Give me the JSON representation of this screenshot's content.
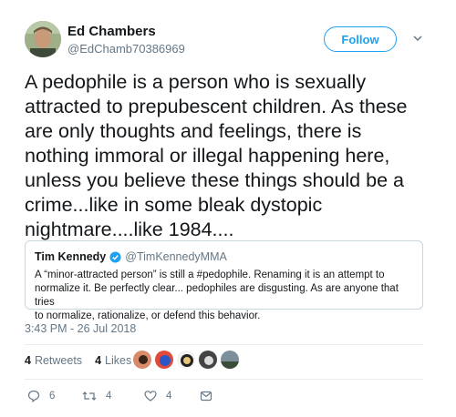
{
  "user": {
    "name": "Ed Chambers",
    "handle": "@EdChamb70386969"
  },
  "follow_label": "Follow",
  "tweet": {
    "text": "A pedophile is a person who is sexually\nattracted to prepubescent children. As these\nare only thoughts and feelings, there is\nnothing immoral or illegal happening here,\nunless you believe these things should be a\ncrime...like in some bleak dystopic\nnightmare....like 1984...."
  },
  "quote": {
    "name": "Tim Kennedy",
    "handle": "@TimKennedyMMA",
    "text": "A “minor-attracted person” is still a #pedophile. Renaming it is an attempt to\nnormalize it.  Be perfectly clear... pedophiles are disgusting. As are anyone that tries\nto normalize, rationalize, or defend this behavior."
  },
  "timestamp": "3:43 PM - 26 Jul 2018",
  "stats": {
    "retweets_count": "4",
    "retweets_label": "Retweets",
    "likes_count": "4",
    "likes_label": "Likes"
  },
  "actions": {
    "reply_count": "6",
    "retweet_count": "4",
    "like_count": "4"
  },
  "colors": {
    "accent": "#1da1f2",
    "muted": "#657786",
    "border": "#ccd6dd"
  }
}
